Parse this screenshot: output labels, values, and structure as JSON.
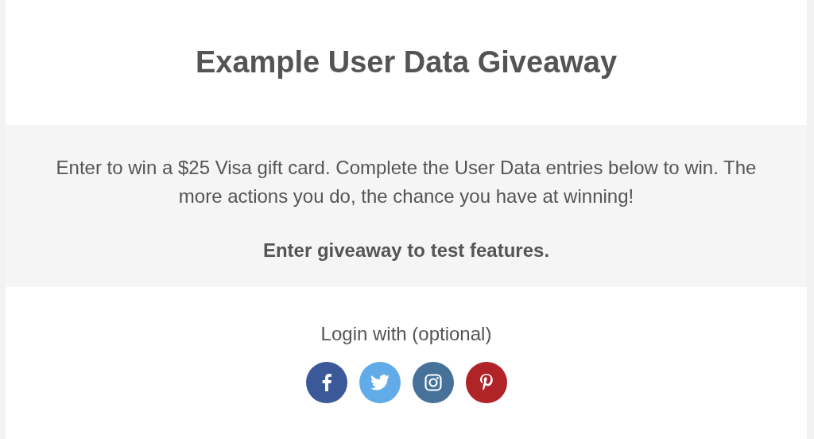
{
  "title": "Example User Data Giveaway",
  "description": "Enter to win a $25 Visa gift card. Complete the User Data entries below to win. The more actions you do, the chance you have at winning!",
  "call_to_action": "Enter giveaway to test features.",
  "login": {
    "label": "Login with (optional)",
    "options": [
      {
        "kind": "facebook",
        "color": "#3b5998"
      },
      {
        "kind": "twitter",
        "color": "#62abe9"
      },
      {
        "kind": "instagram",
        "color": "#46729a"
      },
      {
        "kind": "pinterest",
        "color": "#b02327"
      }
    ]
  }
}
